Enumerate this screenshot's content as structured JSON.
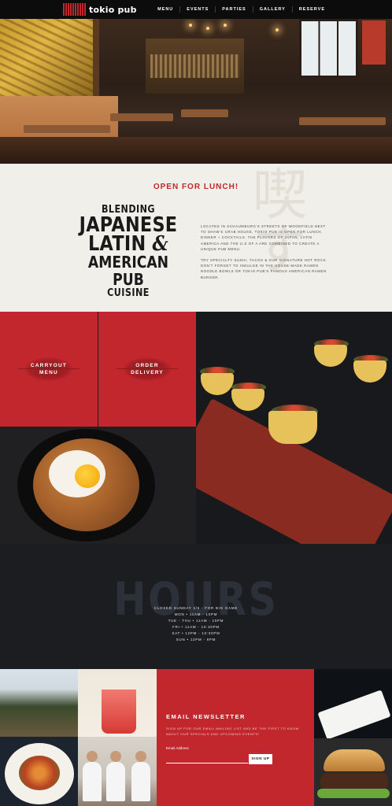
{
  "nav": {
    "logo_text": "tokio pub",
    "items": [
      {
        "label": "MENU"
      },
      {
        "label": "EVENTS"
      },
      {
        "label": "PARTIES"
      },
      {
        "label": "GALLERY"
      },
      {
        "label": "RESERVE"
      }
    ]
  },
  "intro": {
    "watermark": "喫す",
    "tagline": "OPEN FOR LUNCH!",
    "heading": {
      "line1": "BLENDING",
      "line2": "JAPANESE",
      "line3": "LATIN",
      "amp": "&",
      "line4": "AMERICAN PUB",
      "line5": "CUISINE"
    },
    "paragraph1": "Located in Schaumburg's streets of Woodfield next to Shaw's Crab House, Tokio Pub is open for lunch, dinner + cocktails. The flavors of Japan, Latin America and the U.S of A are combined to create a unique pub menu.",
    "paragraph2": "Try specialty sushi, tacos & our signature hot rock. Don't forget to indulge in the house-made ramen noodle bowls or Tokio Pub's famous American ramen burger."
  },
  "tiles": {
    "carryout": {
      "line1": "CARRYOUT",
      "line2": "MENU"
    },
    "order": {
      "line1": "ORDER",
      "line2": "DELIVERY"
    }
  },
  "hours": {
    "title": "HOURS",
    "lines": [
      "CLOSED SUNDAY 2/5 - FOR BIG GAME",
      "MON • 11AM - 10PM",
      "TUE - THU • 11AM - 10PM",
      "FRI • 11AM - 10:30PM",
      "SAT • 12PM - 10:30PM",
      "SUN • 12PM - 9PM"
    ]
  },
  "newsletter": {
    "title": "EMAIL NEWSLETTER",
    "description": "Sign up for our email mailing list and be the first to know about our specials and upcoming events!",
    "email_label": "Email Address",
    "email_value": "",
    "button_label": "SIGN UP"
  },
  "colors": {
    "brand_red": "#c1272d",
    "dark": "#1c1d20",
    "cream": "#f1efe9"
  }
}
